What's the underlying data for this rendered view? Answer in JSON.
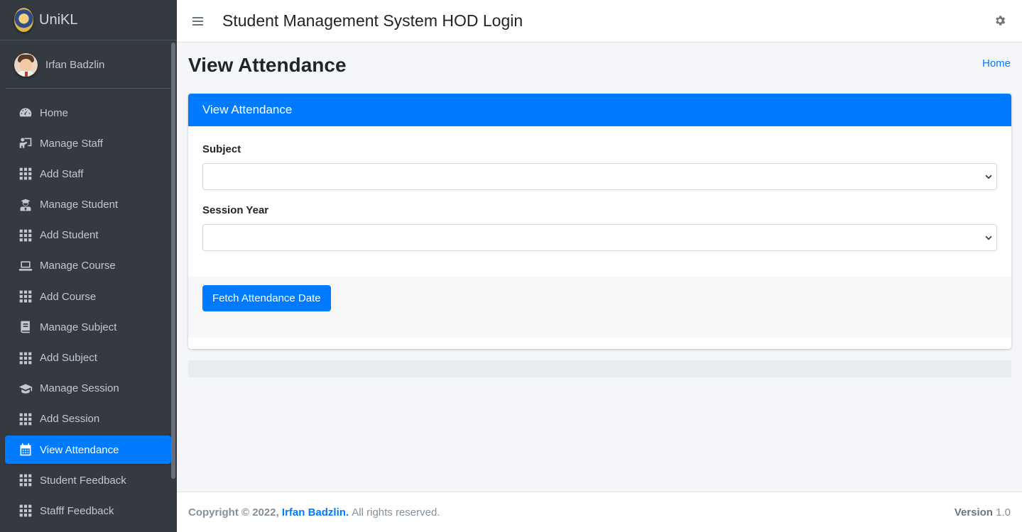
{
  "brand": {
    "name": "UniKL"
  },
  "user": {
    "name": "Irfan Badzlin"
  },
  "sidebar": {
    "items": [
      {
        "label": "Home",
        "icon": "dashboard-gauge-icon",
        "active": false
      },
      {
        "label": "Manage Staff",
        "icon": "chalkboard-teacher-icon",
        "active": false
      },
      {
        "label": "Add Staff",
        "icon": "grid-icon",
        "active": false
      },
      {
        "label": "Manage Student",
        "icon": "user-graduate-icon",
        "active": false
      },
      {
        "label": "Add Student",
        "icon": "grid-icon",
        "active": false
      },
      {
        "label": "Manage Course",
        "icon": "laptop-icon",
        "active": false
      },
      {
        "label": "Add Course",
        "icon": "grid-icon",
        "active": false
      },
      {
        "label": "Manage Subject",
        "icon": "book-icon",
        "active": false
      },
      {
        "label": "Add Subject",
        "icon": "grid-icon",
        "active": false
      },
      {
        "label": "Manage Session",
        "icon": "graduation-cap-icon",
        "active": false
      },
      {
        "label": "Add Session",
        "icon": "grid-icon",
        "active": false
      },
      {
        "label": "View Attendance",
        "icon": "calendar-icon",
        "active": true
      },
      {
        "label": "Student Feedback",
        "icon": "grid-icon",
        "active": false
      },
      {
        "label": "Stafff Feedback",
        "icon": "grid-icon",
        "active": false
      }
    ]
  },
  "header": {
    "title": "Student Management System HOD Login"
  },
  "page": {
    "title": "View Attendance",
    "breadcrumb": "Home"
  },
  "card": {
    "title": "View Attendance",
    "subject_label": "Subject",
    "subject_value": "",
    "session_label": "Session Year",
    "session_value": "",
    "button_label": "Fetch Attendance Date"
  },
  "footer": {
    "copyright_prefix": "Copyright © 2022,",
    "author": "Irfan Badzlin.",
    "rights": "All rights reserved.",
    "version_label": "Version",
    "version_number": "1.0"
  },
  "colors": {
    "primary": "#007bff",
    "sidebar_bg": "#343a40",
    "content_bg": "#f4f6f9"
  }
}
